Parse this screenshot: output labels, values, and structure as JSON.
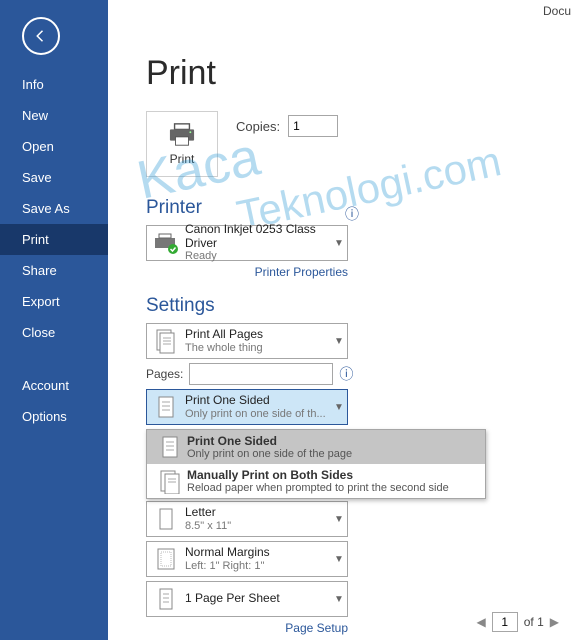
{
  "docTab": "Docu",
  "sidebar": {
    "items": [
      "Info",
      "New",
      "Open",
      "Save",
      "Save As",
      "Print",
      "Share",
      "Export",
      "Close",
      "Account",
      "Options"
    ]
  },
  "title": "Print",
  "printButtonLabel": "Print",
  "copies": {
    "label": "Copies:",
    "value": "1"
  },
  "printer": {
    "heading": "Printer",
    "name": "Canon Inkjet 0253 Class Driver",
    "status": "Ready",
    "propertiesLink": "Printer Properties"
  },
  "settings": {
    "heading": "Settings",
    "printPages": {
      "t1": "Print All Pages",
      "t2": "The whole thing"
    },
    "pagesLabel": "Pages:",
    "pagesValue": "",
    "sides": {
      "t1": "Print One Sided",
      "t2": "Only print on one side of th..."
    },
    "sidesOptions": [
      {
        "t1": "Print One Sided",
        "t2": "Only print on one side of the page"
      },
      {
        "t1": "Manually Print on Both Sides",
        "t2": "Reload paper when prompted to print the second side"
      }
    ],
    "paper": {
      "t1": "Letter",
      "t2": "8.5\" x 11\""
    },
    "margins": {
      "t1": "Normal Margins",
      "t2": "Left:  1\"    Right:  1\""
    },
    "sheet": {
      "t1": "1 Page Per Sheet"
    },
    "pageSetupLink": "Page Setup"
  },
  "pager": {
    "current": "1",
    "of": "of 1"
  },
  "watermark": {
    "line1": "Kaca",
    "line2": "Teknologi.com"
  }
}
